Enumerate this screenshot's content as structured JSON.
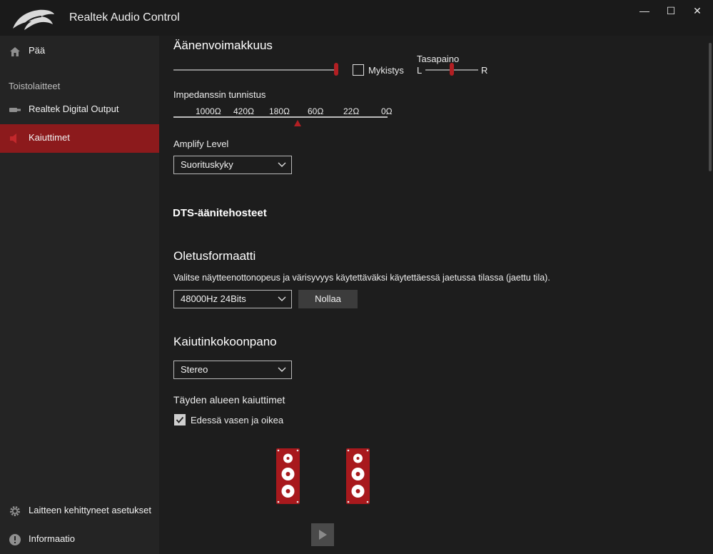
{
  "window": {
    "title": "Realtek Audio Control",
    "minimize_glyph": "—",
    "maximize_glyph": "☐",
    "close_glyph": "✕"
  },
  "sidebar": {
    "items": [
      {
        "label": "Pää",
        "icon": "home-icon"
      },
      {
        "label": "Realtek Digital Output",
        "icon": "digital-output-icon"
      },
      {
        "label": "Kaiuttimet",
        "icon": "speaker-icon"
      }
    ],
    "section_label": "Toistolaitteet",
    "bottom": [
      {
        "label": "Laitteen kehittyneet asetukset",
        "icon": "gear-icon"
      },
      {
        "label": "Informaatio",
        "icon": "info-icon"
      }
    ]
  },
  "volume": {
    "heading": "Äänenvoimakkuus",
    "level": 1.0,
    "mute_label": "Mykistys",
    "mute_checked": false,
    "balance_label": "Tasapaino",
    "balance_left": "L",
    "balance_right": "R",
    "balance": 0.5
  },
  "impedance": {
    "label": "Impedanssin tunnistus",
    "ticks": [
      "1000Ω",
      "420Ω",
      "180Ω",
      "60Ω",
      "22Ω",
      "0Ω"
    ],
    "marker": "180Ω–60Ω"
  },
  "amplify": {
    "label": "Amplify Level",
    "value": "Suorituskyky"
  },
  "dts": {
    "heading": "DTS-äänitehosteet"
  },
  "default_format": {
    "heading": "Oletusformaatti",
    "description": "Valitse näytteenottonopeus ja värisyvyys käytettäväksi käytettäessä jaetussa tilassa (jaettu tila).",
    "value": "48000Hz 24Bits",
    "reset_label": "Nollaa"
  },
  "speaker_config": {
    "heading": "Kaiutinkokoonpano",
    "value": "Stereo",
    "fullrange_label": "Täyden alueen kaiuttimet",
    "front_label": "Edessä vasen ja oikea",
    "front_checked": true
  },
  "colors": {
    "accent": "#b21f23",
    "active_nav": "#8c1a1c",
    "background": "#1d1d1d",
    "sidebar": "#242424"
  }
}
